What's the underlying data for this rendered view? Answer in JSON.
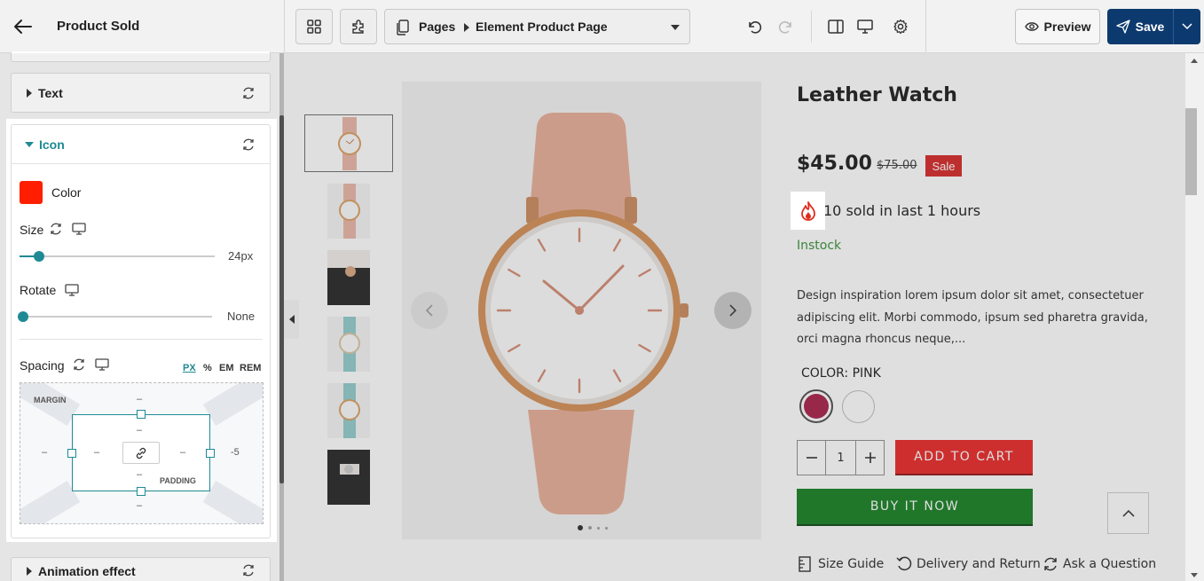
{
  "header": {
    "back_icon": "arrow-left-icon",
    "title": "Product Sold",
    "breadcrumb_root": "Pages",
    "breadcrumb_page": "Element Product Page",
    "preview_label": "Preview",
    "save_label": "Save"
  },
  "panel": {
    "text_section": "Text",
    "icon_section": "Icon",
    "color_label": "Color",
    "color_value": "#ff1f00",
    "size_label": "Size",
    "size_value": "24px",
    "size_slider_fraction": 0.1,
    "rotate_label": "Rotate",
    "rotate_value": "None",
    "rotate_slider_fraction": 0.0,
    "spacing_label": "Spacing",
    "units": [
      "PX",
      "%",
      "EM",
      "REM"
    ],
    "active_unit": "PX",
    "margin_label": "MARGIN",
    "padding_label": "PADDING",
    "margin_top": "–",
    "margin_left": "–",
    "margin_right": "-5",
    "margin_bottom": "–",
    "padding_top": "–",
    "padding_left": "–",
    "padding_right": "–",
    "padding_bottom": "–",
    "animation_section": "Animation effect"
  },
  "product": {
    "title": "Leather Watch",
    "price": "$45.00",
    "compare_price": "$75.00",
    "sale_badge": "Sale",
    "sold_text": "10 sold in last 1 hours",
    "stock": "Instock",
    "description": "Design inspiration lorem ipsum dolor sit amet, consectetuer adipiscing elit. Morbi commodo, ipsum sed pharetra gravida, orci magna rhoncus neque,...",
    "color_label": "COLOR:",
    "color_value": "PINK",
    "swatches": [
      "#a3153f",
      "#ffffff"
    ],
    "quantity": "1",
    "add_to_cart": "ADD TO CART",
    "buy_now": "BUY IT NOW",
    "links": [
      "Size Guide",
      "Delivery and Return",
      "Ask a Question"
    ]
  },
  "colors": {
    "accent": "#1f8a94",
    "save_bg": "#0d3a6e",
    "sale_badge": "#d41e1e",
    "add_to_cart": "#e81e1e",
    "buy_now": "#0b7a18",
    "stock": "#2f8a2f"
  }
}
